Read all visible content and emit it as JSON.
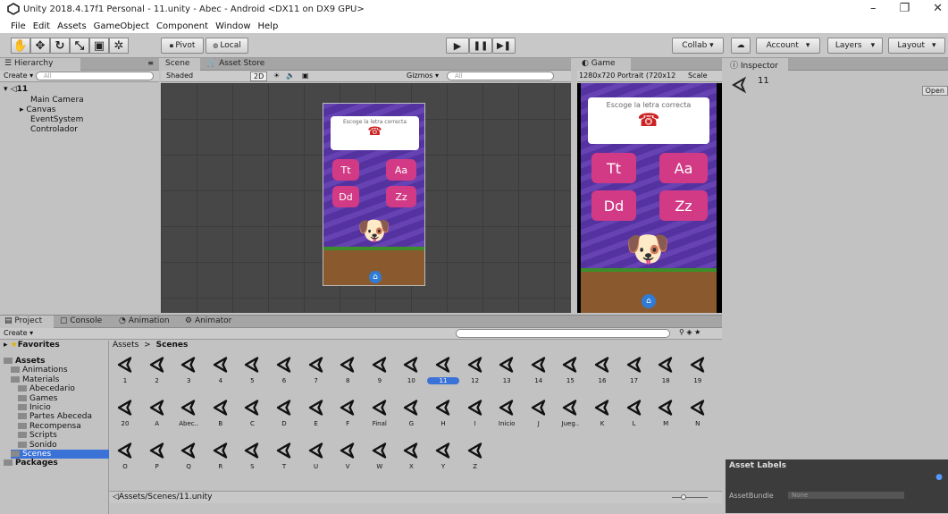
{
  "titlebar": {
    "title": "Unity 2018.4.17f1 Personal - 11.unity - Abec - Android <DX11 on DX9 GPU>"
  },
  "menu": [
    "File",
    "Edit",
    "Assets",
    "GameObject",
    "Component",
    "Window",
    "Help"
  ],
  "toolbar": {
    "pivot": "Pivot",
    "local": "Local",
    "collab": "Collab ▾",
    "account": "Account",
    "layers": "Layers",
    "layout": "Layout"
  },
  "hierarchy": {
    "tab": "Hierarchy",
    "create": "Create ▾",
    "search_placeholder": "All",
    "root": "11",
    "items": [
      "Main Camera",
      "Canvas",
      "EventSystem",
      "Controlador"
    ]
  },
  "scene": {
    "tab_scene": "Scene",
    "tab_store": "Asset Store",
    "shaded": "Shaded",
    "mode2d": "2D",
    "gizmos": "Gizmos ▾",
    "search_placeholder": "All"
  },
  "game": {
    "tab": "Game",
    "resolution": "1280x720 Portrait (720x12",
    "scale": "Scale"
  },
  "app": {
    "prompt": "Escoge la letra correcta",
    "letters": [
      "Tt",
      "Aa",
      "Dd",
      "Zz"
    ]
  },
  "inspector": {
    "tab": "Inspector",
    "object": "11",
    "open": "Open",
    "asset_labels": "Asset Labels",
    "assetbundle": "AssetBundle",
    "none": "None"
  },
  "project": {
    "tabs": [
      "Project",
      "Console",
      "Animation",
      "Animator"
    ],
    "create": "Create ▾",
    "favorites": "Favorites",
    "breadcrumb_root": "Assets",
    "breadcrumb_sep": ">",
    "breadcrumb_leaf": "Scenes",
    "path": "Assets/Scenes/11.unity",
    "tree": [
      {
        "label": "Assets",
        "indent": 0,
        "bold": true
      },
      {
        "label": "Animations",
        "indent": 1
      },
      {
        "label": "Materials",
        "indent": 1
      },
      {
        "label": "Abecedario",
        "indent": 2
      },
      {
        "label": "Games",
        "indent": 2
      },
      {
        "label": "Inicio",
        "indent": 2
      },
      {
        "label": "Partes Abeceda",
        "indent": 2
      },
      {
        "label": "Recompensa",
        "indent": 2
      },
      {
        "label": "Scripts",
        "indent": 2
      },
      {
        "label": "Sonido",
        "indent": 2
      },
      {
        "label": "Scenes",
        "indent": 1,
        "selected": true
      },
      {
        "label": "Packages",
        "indent": 0,
        "bold": true
      }
    ],
    "row1": [
      "1",
      "2",
      "3",
      "4",
      "5",
      "6",
      "7",
      "8",
      "9",
      "10",
      "11",
      "12",
      "13",
      "14",
      "15",
      "16",
      "17",
      "18",
      "19"
    ],
    "row2": [
      "20",
      "A",
      "Abec..",
      "B",
      "C",
      "D",
      "E",
      "F",
      "Final",
      "G",
      "H",
      "I",
      "Inicio",
      "J",
      "Jueg..",
      "K",
      "L",
      "M",
      "N"
    ],
    "row3": [
      "O",
      "P",
      "Q",
      "R",
      "S",
      "T",
      "U",
      "V",
      "W",
      "X",
      "Y",
      "Z"
    ],
    "selected": "11"
  },
  "colors": {
    "selection": "#3a72d8",
    "letter_bg": "#d23a86",
    "phone_bg": "#5a3aa5"
  }
}
